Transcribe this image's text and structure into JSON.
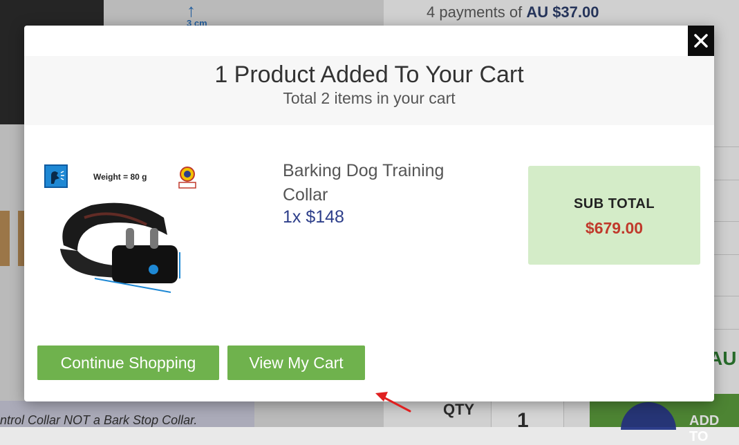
{
  "background": {
    "payments_prefix": "4 payments of ",
    "payments_amount": "AU $37.00",
    "dim_label": "3 cm",
    "currency_fragment": "AU",
    "bottom_text": "ntrol Collar NOT a Bark Stop Collar.",
    "qty_label": "QTY",
    "qty_value": "1",
    "add_button_fragment": "ADD TO"
  },
  "modal": {
    "title": "1 Product Added To Your Cart",
    "subtitle": "Total 2 items in your cart",
    "close_icon": "close-icon",
    "product": {
      "image_weight_label": "Weight  = 80 g",
      "name": "Barking Dog Training Collar",
      "quantity_price": "1x $148"
    },
    "subtotal": {
      "label": "SUB TOTAL",
      "value": "$679.00"
    },
    "buttons": {
      "continue_label": "Continue Shopping",
      "view_cart_label": "View My Cart"
    }
  },
  "colors": {
    "button_green": "#6fb24d",
    "subtotal_bg": "#d4ecc8",
    "subtotal_price": "#c0392b",
    "price_blue": "#2d3e8a",
    "annotation_arrow": "#e02020"
  }
}
